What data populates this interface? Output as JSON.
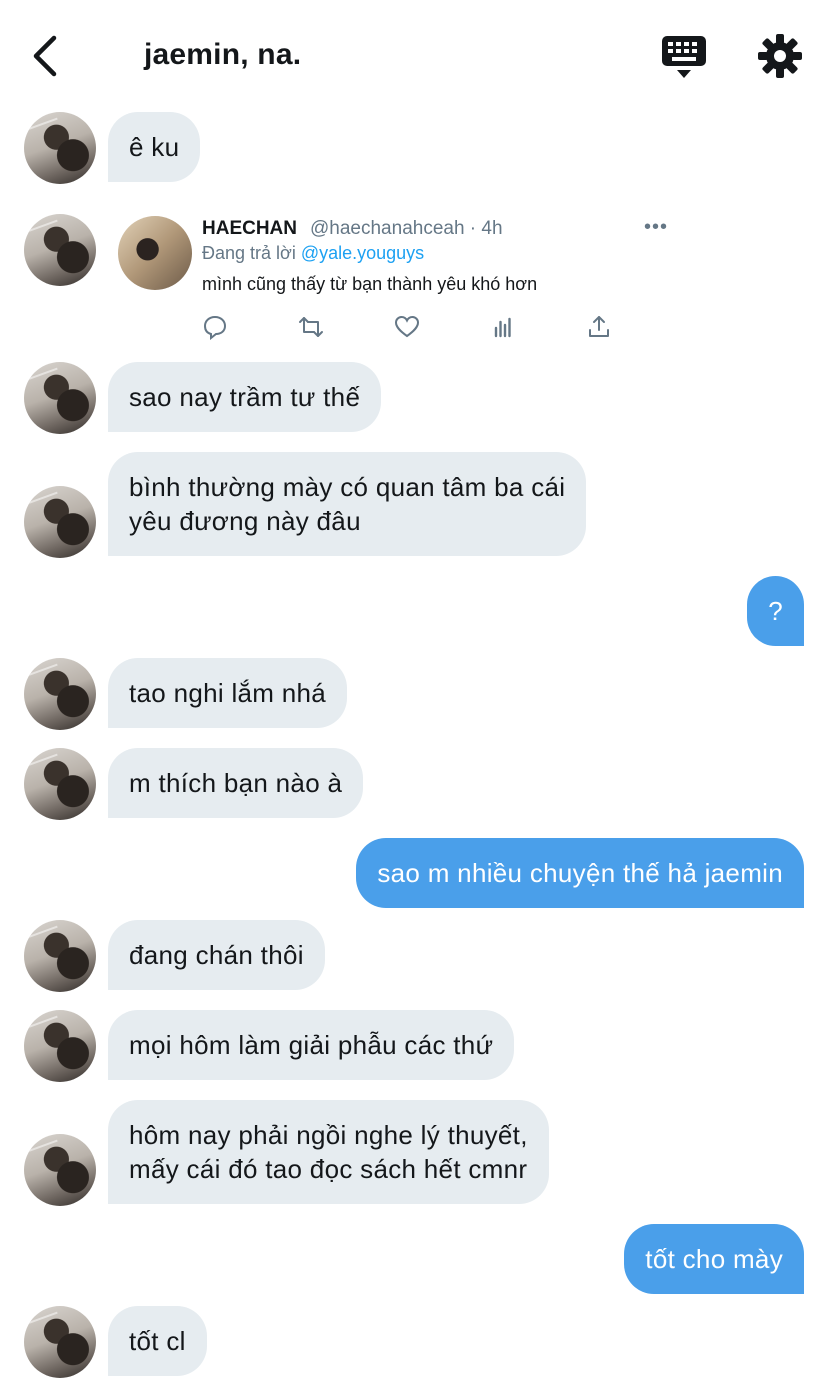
{
  "header": {
    "title": "jaemin, na."
  },
  "colors": {
    "incoming_bubble": "#e6ecf0",
    "outgoing_bubble": "#4a9fea",
    "link": "#1da1f2",
    "muted": "#657786"
  },
  "icons": [
    "back-arrow-icon",
    "keyboard-icon",
    "gear-icon",
    "reply-icon",
    "retweet-icon",
    "like-icon",
    "analytics-icon",
    "share-icon",
    "more-icon"
  ],
  "tweet": {
    "name": "HAECHAN",
    "handle_time": "@haechanahceah · 4h",
    "replying_prefix": "Đang trả lời ",
    "replying_handle": "@yale.youguys",
    "text": "mình cũng thấy từ bạn thành yêu khó hơn",
    "more": "•••"
  },
  "messages": [
    {
      "from": "them",
      "text": "ê ku"
    },
    {
      "from": "them",
      "text": "sao nay trầm tư thế"
    },
    {
      "from": "them",
      "text": "bình thường mày có quan tâm ba cái\nyêu đương này đâu"
    },
    {
      "from": "me",
      "text": "?"
    },
    {
      "from": "them",
      "text": "tao nghi lắm nhá"
    },
    {
      "from": "them",
      "text": "m thích bạn nào à"
    },
    {
      "from": "me",
      "text": "sao m nhiều chuyện thế hả jaemin"
    },
    {
      "from": "them",
      "text": "đang chán thôi"
    },
    {
      "from": "them",
      "text": "mọi hôm làm giải phẫu các thứ"
    },
    {
      "from": "them",
      "text": "hôm nay phải ngồi nghe lý thuyết,\nmấy cái đó tao đọc sách hết cmnr"
    },
    {
      "from": "me",
      "text": "tốt cho mày"
    },
    {
      "from": "them",
      "text": "tốt cl"
    }
  ]
}
